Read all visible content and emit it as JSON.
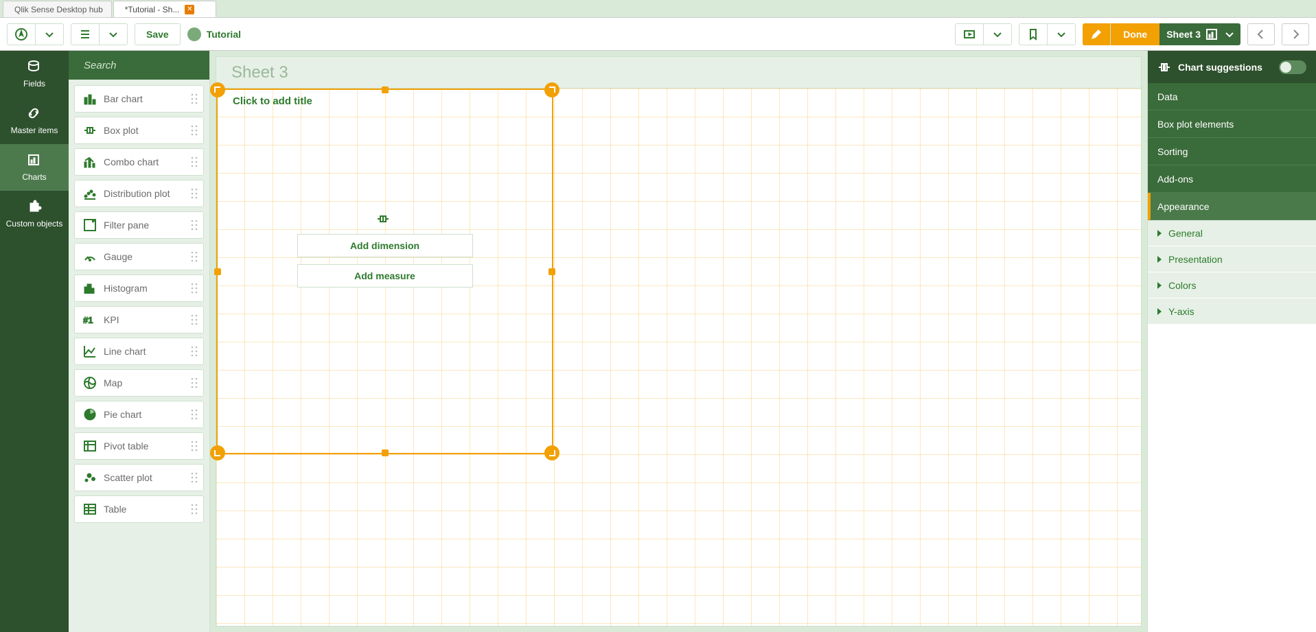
{
  "tabs": [
    {
      "label": "Qlik Sense Desktop hub",
      "active": false,
      "closable": false
    },
    {
      "label": "*Tutorial - Sh...",
      "active": true,
      "closable": true
    }
  ],
  "toolbar": {
    "save_label": "Save",
    "app_label": "Tutorial",
    "done_label": "Done",
    "sheet_label": "Sheet 3"
  },
  "rail": [
    {
      "key": "fields",
      "label": "Fields"
    },
    {
      "key": "master",
      "label": "Master items"
    },
    {
      "key": "charts",
      "label": "Charts"
    },
    {
      "key": "custom",
      "label": "Custom objects"
    }
  ],
  "search": {
    "placeholder": "Search"
  },
  "charts": [
    {
      "icon": "bar",
      "label": "Bar chart"
    },
    {
      "icon": "boxplot",
      "label": "Box plot"
    },
    {
      "icon": "combo",
      "label": "Combo chart"
    },
    {
      "icon": "distribution",
      "label": "Distribution plot"
    },
    {
      "icon": "filter",
      "label": "Filter pane"
    },
    {
      "icon": "gauge",
      "label": "Gauge"
    },
    {
      "icon": "histogram",
      "label": "Histogram"
    },
    {
      "icon": "kpi",
      "label": "KPI"
    },
    {
      "icon": "line",
      "label": "Line chart"
    },
    {
      "icon": "map",
      "label": "Map"
    },
    {
      "icon": "pie",
      "label": "Pie chart"
    },
    {
      "icon": "pivot",
      "label": "Pivot table"
    },
    {
      "icon": "scatter",
      "label": "Scatter plot"
    },
    {
      "icon": "table",
      "label": "Table"
    }
  ],
  "canvas": {
    "sheet_title": "Sheet 3",
    "object_title_placeholder": "Click to add title",
    "add_dimension_label": "Add dimension",
    "add_measure_label": "Add measure"
  },
  "props": {
    "header": "Chart suggestions",
    "sections": [
      {
        "label": "Data"
      },
      {
        "label": "Box plot elements"
      },
      {
        "label": "Sorting"
      },
      {
        "label": "Add-ons"
      },
      {
        "label": "Appearance",
        "selected": true
      }
    ],
    "appearance_subs": [
      {
        "label": "General"
      },
      {
        "label": "Presentation"
      },
      {
        "label": "Colors"
      },
      {
        "label": "Y-axis"
      }
    ]
  }
}
